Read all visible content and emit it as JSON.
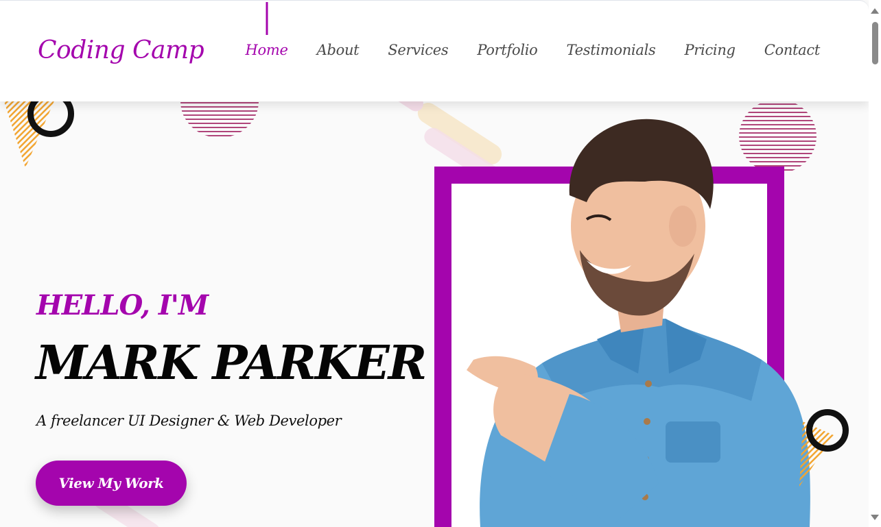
{
  "brand": {
    "logo_text": "Coding Camp",
    "accent_color": "#a405ad"
  },
  "nav": {
    "items": [
      {
        "label": "Home",
        "active": true
      },
      {
        "label": "About",
        "active": false
      },
      {
        "label": "Services",
        "active": false
      },
      {
        "label": "Portfolio",
        "active": false
      },
      {
        "label": "Testimonials",
        "active": false
      },
      {
        "label": "Pricing",
        "active": false
      },
      {
        "label": "Contact",
        "active": false
      }
    ]
  },
  "hero": {
    "greeting": "HELLO, I'M",
    "name": "MARK PARKER",
    "tagline": "A freelancer UI Designer & Web Developer",
    "cta_label": "View My Work",
    "portrait_icon": "man-pointing-portrait"
  },
  "colors": {
    "stripe": "#b0457a",
    "triangle": "#f2a531",
    "ring": "#111111"
  }
}
